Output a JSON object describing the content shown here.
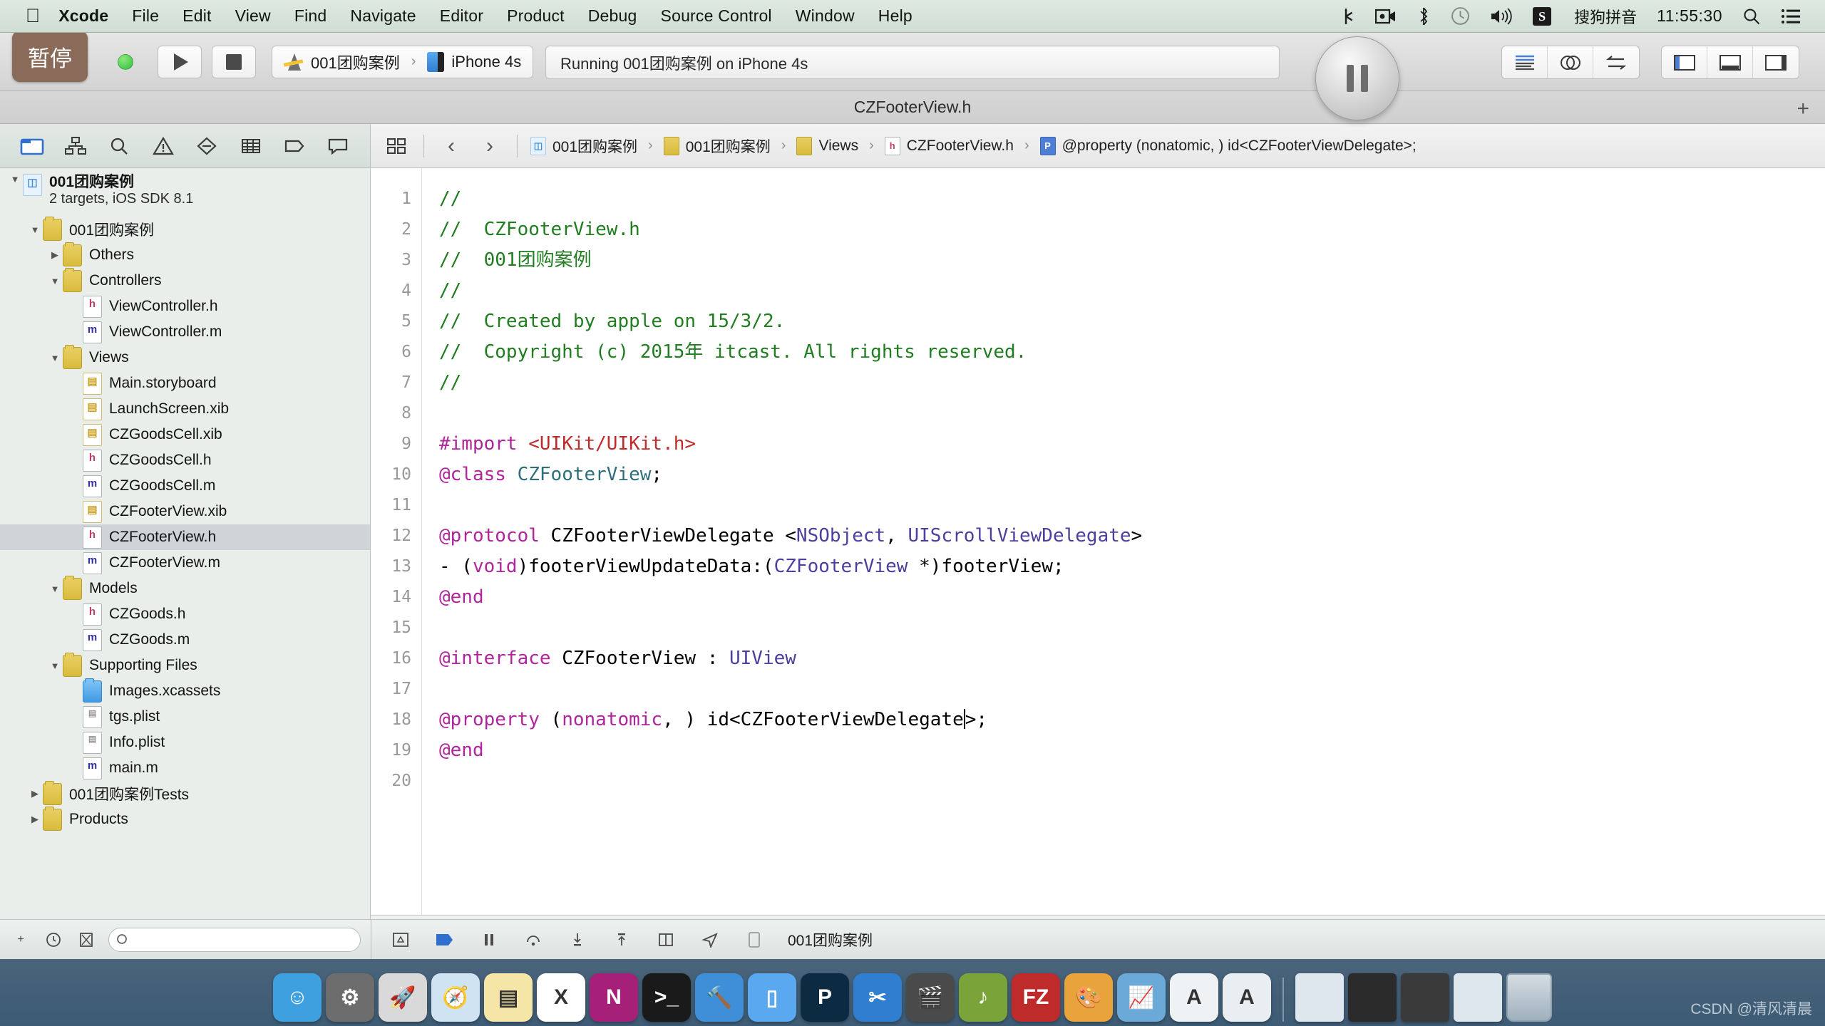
{
  "menubar": {
    "apple_icon": "apple-icon",
    "items": [
      "Xcode",
      "File",
      "Edit",
      "View",
      "Find",
      "Navigate",
      "Editor",
      "Product",
      "Debug",
      "Source Control",
      "Window",
      "Help"
    ],
    "status_icons": [
      "bluetooth-tether-icon",
      "screen-record-icon",
      "bluetooth-icon",
      "timemachine-icon",
      "volume-icon"
    ],
    "ime_badge": "S",
    "ime_label": "搜狗拼音",
    "clock": "11:55:30",
    "search_icon": "search-icon",
    "notification_icon": "notification-center-icon"
  },
  "toolbar": {
    "pause_overlay_label": "暂停",
    "run_button": "run-button",
    "stop_button": "stop-button",
    "scheme_project": "001团购案例",
    "scheme_separator": "›",
    "scheme_device": "iPhone 4s",
    "status_text": "Running 001团购案例 on iPhone 4s",
    "big_pause_button": "pause-button",
    "right_buttons": [
      "standard-editor-icon",
      "assistant-editor-icon",
      "version-editor-icon",
      "navigator-toggle-icon",
      "debug-area-toggle-icon",
      "utilities-toggle-icon"
    ]
  },
  "window": {
    "title": "CZFooterView.h",
    "add_tab_label": "+"
  },
  "navigator": {
    "tabs": [
      "project-navigator-icon",
      "symbol-navigator-icon",
      "find-navigator-icon",
      "issue-navigator-icon",
      "test-navigator-icon",
      "debug-navigator-icon",
      "breakpoint-navigator-icon",
      "report-navigator-icon"
    ],
    "project": {
      "name": "001团购案例",
      "subtitle": "2 targets, iOS SDK 8.1"
    },
    "tree": [
      {
        "label": "001团购案例",
        "depth": 1,
        "icon": "folder",
        "twisty": "open"
      },
      {
        "label": "Others",
        "depth": 2,
        "icon": "folder",
        "twisty": "closed"
      },
      {
        "label": "Controllers",
        "depth": 2,
        "icon": "folder",
        "twisty": "open"
      },
      {
        "label": "ViewController.h",
        "depth": 3,
        "icon": "h",
        "twisty": "none"
      },
      {
        "label": "ViewController.m",
        "depth": 3,
        "icon": "m",
        "twisty": "none"
      },
      {
        "label": "Views",
        "depth": 2,
        "icon": "folder",
        "twisty": "open"
      },
      {
        "label": "Main.storyboard",
        "depth": 3,
        "icon": "sb",
        "twisty": "none"
      },
      {
        "label": "LaunchScreen.xib",
        "depth": 3,
        "icon": "xib",
        "twisty": "none"
      },
      {
        "label": "CZGoodsCell.xib",
        "depth": 3,
        "icon": "xib",
        "twisty": "none"
      },
      {
        "label": "CZGoodsCell.h",
        "depth": 3,
        "icon": "h",
        "twisty": "none"
      },
      {
        "label": "CZGoodsCell.m",
        "depth": 3,
        "icon": "m",
        "twisty": "none"
      },
      {
        "label": "CZFooterView.xib",
        "depth": 3,
        "icon": "xib",
        "twisty": "none"
      },
      {
        "label": "CZFooterView.h",
        "depth": 3,
        "icon": "h",
        "twisty": "none",
        "selected": true
      },
      {
        "label": "CZFooterView.m",
        "depth": 3,
        "icon": "m",
        "twisty": "none"
      },
      {
        "label": "Models",
        "depth": 2,
        "icon": "folder",
        "twisty": "open"
      },
      {
        "label": "CZGoods.h",
        "depth": 3,
        "icon": "h",
        "twisty": "none"
      },
      {
        "label": "CZGoods.m",
        "depth": 3,
        "icon": "m",
        "twisty": "none"
      },
      {
        "label": "Supporting Files",
        "depth": 2,
        "icon": "folder",
        "twisty": "open"
      },
      {
        "label": "Images.xcassets",
        "depth": 3,
        "icon": "xcassets",
        "twisty": "none"
      },
      {
        "label": "tgs.plist",
        "depth": 3,
        "icon": "plist",
        "twisty": "none"
      },
      {
        "label": "Info.plist",
        "depth": 3,
        "icon": "plist",
        "twisty": "none"
      },
      {
        "label": "main.m",
        "depth": 3,
        "icon": "m",
        "twisty": "none"
      },
      {
        "label": "001团购案例Tests",
        "depth": 1,
        "icon": "folder",
        "twisty": "closed"
      },
      {
        "label": "Products",
        "depth": 1,
        "icon": "folder",
        "twisty": "closed"
      }
    ],
    "footer": {
      "add_icon": "add-icon",
      "recent_icon": "recent-icon",
      "sourcecontrol_icon": "source-control-filter-icon",
      "filter_placeholder": "",
      "filter_value": ""
    }
  },
  "jumpbar": {
    "left_icons": [
      "related-files-icon",
      "back-chevron-icon",
      "forward-chevron-icon"
    ],
    "back_label": "‹",
    "forward_label": "›",
    "crumbs": [
      {
        "label": "001团购案例",
        "icon": "proj"
      },
      {
        "label": "001团购案例",
        "icon": "fold"
      },
      {
        "label": "Views",
        "icon": "fold"
      },
      {
        "label": "CZFooterView.h",
        "icon": "h"
      },
      {
        "label": "@property (nonatomic, ) id<CZFooterViewDelegate>;",
        "icon": "p"
      }
    ]
  },
  "code": {
    "line_numbers": [
      "1",
      "2",
      "3",
      "4",
      "5",
      "6",
      "7",
      "8",
      "9",
      "10",
      "11",
      "12",
      "13",
      "14",
      "15",
      "16",
      "17",
      "18",
      "19",
      "20"
    ],
    "lines": [
      {
        "n": 1,
        "text": "//"
      },
      {
        "n": 2,
        "text": "//  CZFooterView.h"
      },
      {
        "n": 3,
        "text": "//  001团购案例"
      },
      {
        "n": 4,
        "text": "//"
      },
      {
        "n": 5,
        "text": "//  Created by apple on 15/3/2."
      },
      {
        "n": 6,
        "text": "//  Copyright (c) 2015年 itcast. All rights reserved."
      },
      {
        "n": 7,
        "text": "//"
      },
      {
        "n": 8,
        "text": ""
      },
      {
        "n": 9,
        "text": "#import <UIKit/UIKit.h>"
      },
      {
        "n": 10,
        "text": "@class CZFooterView;"
      },
      {
        "n": 11,
        "text": ""
      },
      {
        "n": 12,
        "text": "@protocol CZFooterViewDelegate <NSObject, UIScrollViewDelegate>"
      },
      {
        "n": 13,
        "text": "- (void)footerViewUpdateData:(CZFooterView *)footerView;"
      },
      {
        "n": 14,
        "text": "@end"
      },
      {
        "n": 15,
        "text": ""
      },
      {
        "n": 16,
        "text": "@interface CZFooterView : UIView"
      },
      {
        "n": 17,
        "text": ""
      },
      {
        "n": 18,
        "text": "@property (nonatomic, ) id<CZFooterViewDelegate>;"
      },
      {
        "n": 19,
        "text": "@end"
      },
      {
        "n": 20,
        "text": ""
      }
    ]
  },
  "debugbar": {
    "left_icons": [
      "add-icon",
      "clock-icon",
      "filter-icon",
      "search-icon"
    ],
    "icons": [
      "hide-debug-icon",
      "activate-breakpoints-icon",
      "pause-icon",
      "step-over-icon",
      "step-into-icon",
      "step-out-icon",
      "view-hierarchy-icon",
      "location-icon"
    ],
    "process_label": "001团购案例"
  },
  "dock": {
    "items": [
      {
        "name": "finder",
        "color": "#3fa0e0",
        "glyph": "☺"
      },
      {
        "name": "system-preferences",
        "color": "#6d6d6d",
        "glyph": "⚙"
      },
      {
        "name": "launchpad",
        "color": "#d9d9d9",
        "glyph": "🚀"
      },
      {
        "name": "safari",
        "color": "#cfe3f2",
        "glyph": "🧭"
      },
      {
        "name": "notes",
        "color": "#f5e6a8",
        "glyph": "▤"
      },
      {
        "name": "excel",
        "color": "#ffffff",
        "glyph": "X"
      },
      {
        "name": "onenote",
        "color": "#a6207a",
        "glyph": "N"
      },
      {
        "name": "terminal",
        "color": "#1a1a1a",
        "glyph": ">_"
      },
      {
        "name": "xcode",
        "color": "#3f8fd8",
        "glyph": "🔨"
      },
      {
        "name": "simulator",
        "color": "#5aa9f0",
        "glyph": "▯"
      },
      {
        "name": "photoshop",
        "color": "#0d2a43",
        "glyph": "P"
      },
      {
        "name": "snipping-tool",
        "color": "#2f7ed0",
        "glyph": "✂"
      },
      {
        "name": "imovie",
        "color": "#4a4a4a",
        "glyph": "🎬"
      },
      {
        "name": "mp3-tool",
        "color": "#7aa33a",
        "glyph": "♪"
      },
      {
        "name": "filezilla",
        "color": "#bf2b2b",
        "glyph": "FZ"
      },
      {
        "name": "paint",
        "color": "#e8a33d",
        "glyph": "🎨"
      },
      {
        "name": "chart-app",
        "color": "#6aa9d8",
        "glyph": "📈"
      },
      {
        "name": "preview",
        "color": "#eef2f5",
        "glyph": "A"
      },
      {
        "name": "sketch",
        "color": "#e9eef2",
        "glyph": "A"
      }
    ],
    "recent": [
      {
        "name": "recent-window-1",
        "color": "#dfe7ee"
      },
      {
        "name": "recent-window-2",
        "color": "#2b2b2b"
      },
      {
        "name": "recent-window-3",
        "color": "#3a3a3a"
      },
      {
        "name": "recent-window-4",
        "color": "#dfe7ee"
      }
    ],
    "trash": "trash-icon"
  },
  "watermark": "CSDN @清风清晨"
}
